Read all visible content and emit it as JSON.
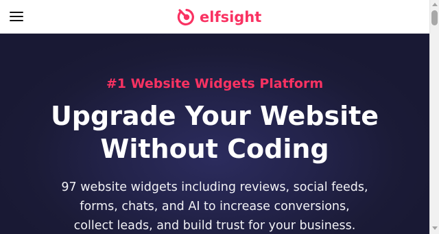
{
  "header": {
    "menu_icon": "hamburger-menu-icon",
    "logo_icon": "elfsight-logo-icon",
    "logo_text": "elfsight"
  },
  "hero": {
    "eyebrow": "#1 Website Widgets Platform",
    "headline_line1": "Upgrade Your Website",
    "headline_line2": "Without Coding",
    "subtext_line1": "97 website widgets including reviews, social feeds,",
    "subtext_line2": "forms, chats, and AI to increase conversions,",
    "subtext_line3": "collect leads, and build trust for your business."
  },
  "colors": {
    "brand": "#f93262",
    "hero_background": "#1d1d3a",
    "header_background": "#ffffff",
    "text_light": "#ffffff"
  }
}
